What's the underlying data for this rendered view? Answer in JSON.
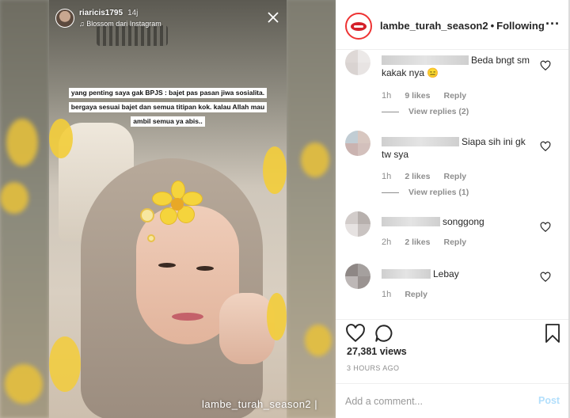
{
  "story": {
    "username": "riaricis1795",
    "time": "14j",
    "music": "Blossom dari Instagram",
    "caption_lines": [
      "yang penting saya gak BPJS : bajet pas pasan jiwa sosialita.",
      "bergaya sesuai bajet dan semua titipan kok. kalau Allah mau",
      "ambil semua ya abis.."
    ],
    "watermark": "lambe_turah_season2 |",
    "close_icon": "close-icon"
  },
  "header": {
    "username": "lambe_turah_season2",
    "separator": "•",
    "follow_status": "Following",
    "more_icon": "more-icon"
  },
  "comments": [
    {
      "text": "Beda bngt sm kakak nya 😑",
      "time": "1h",
      "likes": "9 likes",
      "reply": "Reply",
      "view_replies": "View replies (2)",
      "avatar_colors": [
        "#ded8d6",
        "#ece9e8",
        "#d9d3d1",
        "#e8e4e3"
      ]
    },
    {
      "text": "Siapa sih ini gk tw sya",
      "time": "1h",
      "likes": "2 likes",
      "reply": "Reply",
      "view_replies": "View replies (1)",
      "avatar_colors": [
        "#c1cdd4",
        "#d8c7c0",
        "#cab3b0",
        "#d3c0bc"
      ]
    },
    {
      "text": "songgong",
      "time": "2h",
      "likes": "2 likes",
      "reply": "Reply",
      "view_replies": "",
      "avatar_colors": [
        "#d2ccca",
        "#b7b0ad",
        "#e6e2e1",
        "#c9c3c1"
      ]
    },
    {
      "text": "Lebay",
      "time": "1h",
      "likes": "",
      "reply": "Reply",
      "view_replies": "",
      "avatar_colors": [
        "#8e8785",
        "#a5a09e",
        "#bdb7b6",
        "#9a9391"
      ]
    }
  ],
  "actions": {
    "views": "27,381 views",
    "time_ago": "3 HOURS AGO",
    "comment_placeholder": "Add a comment...",
    "post_label": "Post",
    "heart_icon": "heart-outline-icon",
    "comment_icon": "comment-bubble-icon",
    "save_icon": "bookmark-icon"
  }
}
